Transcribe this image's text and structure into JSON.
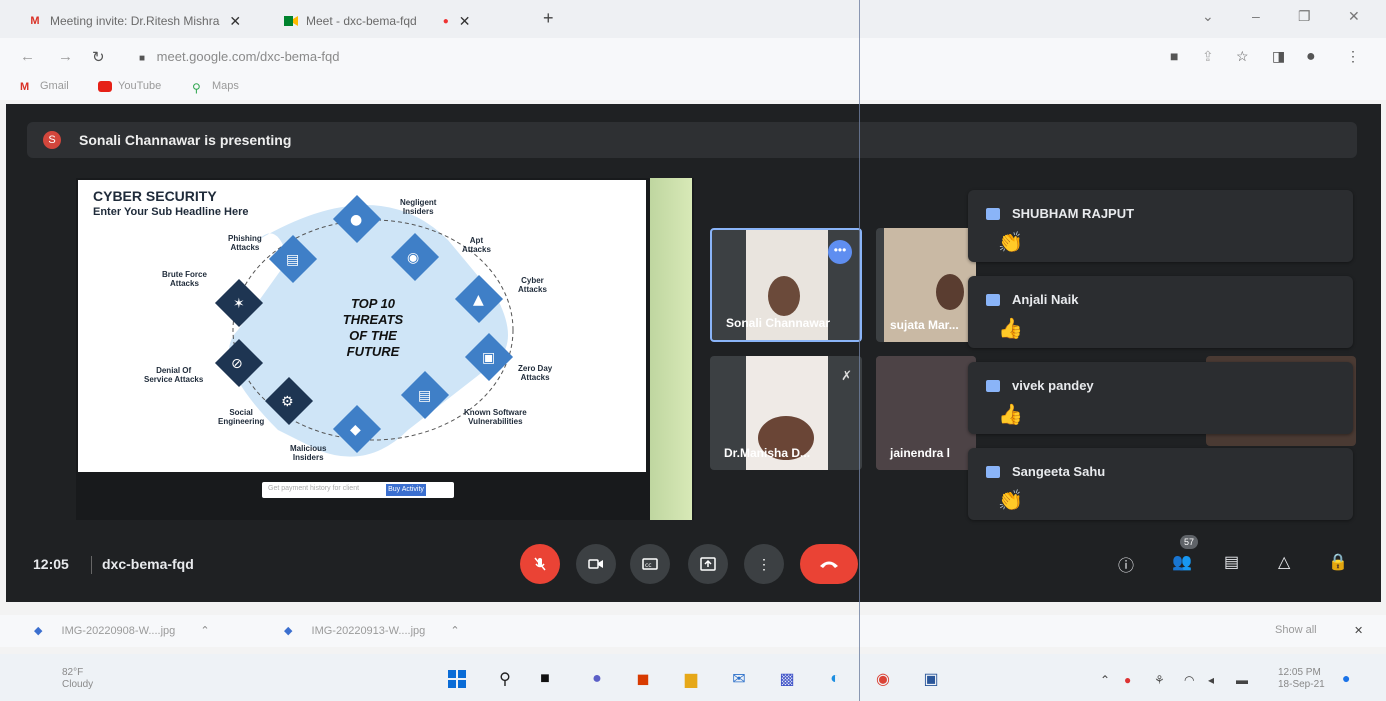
{
  "browser": {
    "tabs": [
      {
        "label": "Meeting invite: Dr.Ritesh Mishra",
        "close": "✕"
      },
      {
        "label": "Meet - dxc-bema-fqd",
        "close": "✕"
      }
    ],
    "new_tab": "+",
    "url": "meet.google.com/dxc-bema-fqd",
    "bookmarks": [
      "Gmail",
      "YouTube",
      "Maps"
    ]
  },
  "meet": {
    "presenter_initial": "S",
    "presenting_text": "Sonali Channawar is presenting",
    "slide": {
      "title": "CYBER SECURITY",
      "subtitle": "Enter Your Sub Headline Here",
      "center_title": [
        "TOP 10",
        "THREATS",
        "OF THE",
        "FUTURE"
      ],
      "labels": {
        "negligent": "Negligent\nInsiders",
        "phishing": "Phishing\nAttacks",
        "apt": "Apt\nAttacks",
        "brute": "Brute Force\nAttacks",
        "cyber": "Cyber\nAttacks",
        "zero": "Zero Day\nAttacks",
        "denial": "Denial Of\nService Attacks",
        "known": "Known Software\nVulnerabilities",
        "social": "Social\nEngineering",
        "malicious": "Malicious\nInsiders"
      },
      "search_placeholder": "Get payment history for client",
      "search_button": "Buy Activity"
    },
    "tiles": [
      {
        "name": "Sonali Channawar"
      },
      {
        "name": "sujata Mar..."
      },
      {
        "name": "Dr.Manisha D..."
      },
      {
        "name": "jainendra l"
      }
    ],
    "reactions": [
      {
        "name": "SHUBHAM RAJPUT",
        "emoji": "👏"
      },
      {
        "name": "Anjali Naik",
        "emoji": "👍"
      },
      {
        "name": "vivek pandey",
        "emoji": "👍"
      },
      {
        "name": "Sangeeta Sahu",
        "emoji": "👏"
      }
    ],
    "time": "12:05",
    "meeting_code": "dxc-bema-fqd",
    "participants_count": "57"
  },
  "downloads": [
    {
      "name": "IMG-20220908-W....jpg"
    },
    {
      "name": "IMG-20220913-W....jpg"
    }
  ],
  "downloads_show_all": "Show all",
  "taskbar": {
    "temp": "82°F",
    "weather": "Cloudy",
    "time": "12:05 PM",
    "date": "18-Sep-21"
  }
}
